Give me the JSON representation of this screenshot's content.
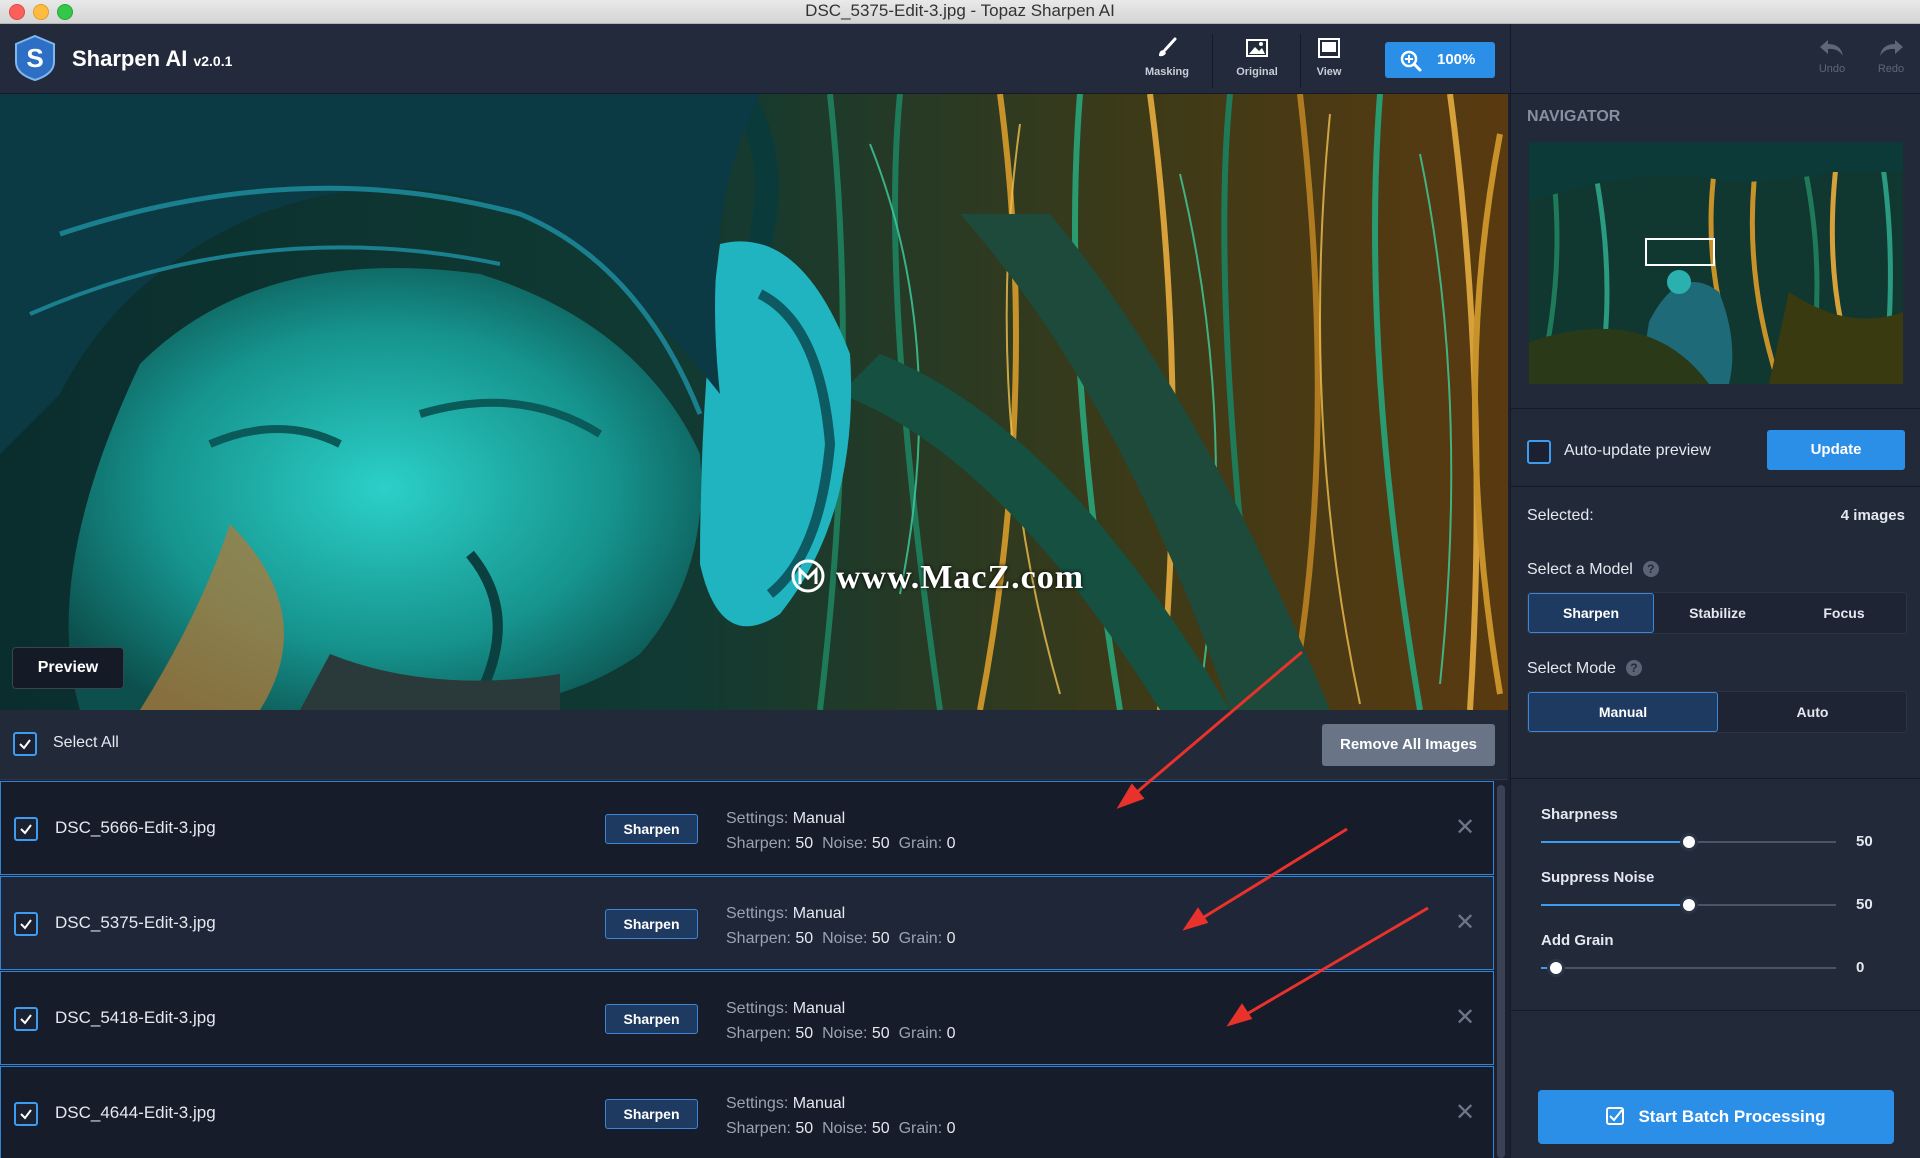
{
  "window": {
    "title": "DSC_5375-Edit-3.jpg - Topaz Sharpen AI"
  },
  "app": {
    "name": "Sharpen AI",
    "version": "v2.0.1"
  },
  "toolbar": {
    "masking_label": "Masking",
    "original_label": "Original",
    "view_label": "View",
    "zoom_label": "100%",
    "undo_label": "Undo",
    "redo_label": "Redo"
  },
  "preview": {
    "button_label": "Preview",
    "watermark": "www.MacZ.com"
  },
  "batch": {
    "select_all_label": "Select All",
    "remove_all_label": "Remove All Images",
    "items": [
      {
        "filename": "DSC_5666-Edit-3.jpg",
        "model": "Sharpen",
        "settings_key": "Settings:",
        "settings_value": "Manual",
        "sharpen_key": "Sharpen:",
        "sharpen_value": "50",
        "noise_key": "Noise:",
        "noise_value": "50",
        "grain_key": "Grain:",
        "grain_value": "0",
        "checked": true
      },
      {
        "filename": "DSC_5375-Edit-3.jpg",
        "model": "Sharpen",
        "settings_key": "Settings:",
        "settings_value": "Manual",
        "sharpen_key": "Sharpen:",
        "sharpen_value": "50",
        "noise_key": "Noise:",
        "noise_value": "50",
        "grain_key": "Grain:",
        "grain_value": "0",
        "checked": true
      },
      {
        "filename": "DSC_5418-Edit-3.jpg",
        "model": "Sharpen",
        "settings_key": "Settings:",
        "settings_value": "Manual",
        "sharpen_key": "Sharpen:",
        "sharpen_value": "50",
        "noise_key": "Noise:",
        "noise_value": "50",
        "grain_key": "Grain:",
        "grain_value": "0",
        "checked": true
      },
      {
        "filename": "DSC_4644-Edit-3.jpg",
        "model": "Sharpen",
        "settings_key": "Settings:",
        "settings_value": "Manual",
        "sharpen_key": "Sharpen:",
        "sharpen_value": "50",
        "noise_key": "Noise:",
        "noise_value": "50",
        "grain_key": "Grain:",
        "grain_value": "0",
        "checked": true
      }
    ]
  },
  "panel": {
    "navigator_label": "NAVIGATOR",
    "auto_update_label": "Auto-update preview",
    "auto_update_checked": false,
    "update_label": "Update",
    "selected_label": "Selected:",
    "selected_value": "4 images",
    "model_label": "Select a Model",
    "models": [
      "Sharpen",
      "Stabilize",
      "Focus"
    ],
    "active_model": "Sharpen",
    "mode_label": "Select Mode",
    "modes": [
      "Manual",
      "Auto"
    ],
    "active_mode": "Manual",
    "sliders": [
      {
        "label": "Sharpness",
        "value": 50,
        "max": 100
      },
      {
        "label": "Suppress Noise",
        "value": 50,
        "max": 100
      },
      {
        "label": "Add Grain",
        "value": 0,
        "max": 100
      }
    ],
    "batch_button_label": "Start Batch Processing"
  },
  "colors": {
    "accent": "#2b8fe8",
    "panel_bg": "#222939",
    "row_border": "#2f85d3",
    "arrow": "#e8322b"
  }
}
